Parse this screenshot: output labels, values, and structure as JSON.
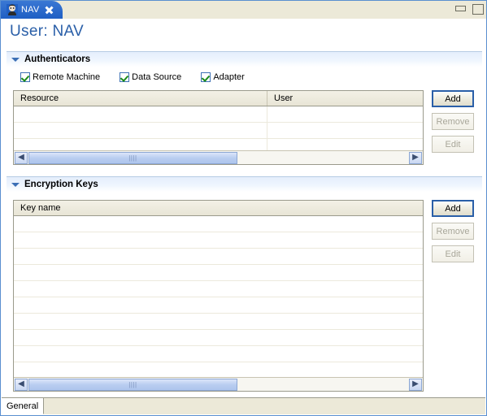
{
  "window": {
    "tab": {
      "label": "NAV",
      "icon": "user-avatar-icon",
      "close_icon": "close-icon"
    },
    "controls": {
      "minimize": "minimize-icon",
      "maximize": "maximize-icon"
    },
    "accent_color": "#2a5fa8",
    "tab_gradient_from": "#3a78d4",
    "tab_gradient_to": "#1f5fc4"
  },
  "page": {
    "title": "User: NAV"
  },
  "sections": [
    {
      "id": "authenticators",
      "title": "Authenticators",
      "expanded": true,
      "twisty_icon": "chevron-down-icon",
      "checkboxes": [
        {
          "label": "Remote Machine",
          "checked": true
        },
        {
          "label": "Data Source",
          "checked": true
        },
        {
          "label": "Adapter",
          "checked": true
        }
      ],
      "table": {
        "columns": [
          "Resource",
          "User"
        ],
        "rows": [],
        "empty_row_count": 4,
        "scrollbar": {
          "left_arrow": "scroll-left-icon",
          "right_arrow": "scroll-right-icon",
          "thumb_percent": 55,
          "thumb_offset_percent": 0,
          "grip": "||||"
        }
      },
      "buttons": [
        {
          "label": "Add",
          "enabled": true,
          "focused": true
        },
        {
          "label": "Remove",
          "enabled": false,
          "focused": false
        },
        {
          "label": "Edit",
          "enabled": false,
          "focused": false
        }
      ]
    },
    {
      "id": "encryption-keys",
      "title": "Encryption Keys",
      "expanded": true,
      "twisty_icon": "chevron-down-icon",
      "checkboxes": [],
      "table": {
        "columns": [
          "Key name"
        ],
        "rows": [],
        "empty_row_count": 10,
        "scrollbar": {
          "left_arrow": "scroll-left-icon",
          "right_arrow": "scroll-right-icon",
          "thumb_percent": 55,
          "thumb_offset_percent": 0,
          "grip": "||||"
        }
      },
      "buttons": [
        {
          "label": "Add",
          "enabled": true,
          "focused": true
        },
        {
          "label": "Remove",
          "enabled": false,
          "focused": false
        },
        {
          "label": "Edit",
          "enabled": false,
          "focused": false
        }
      ]
    }
  ],
  "bottom_tabs": [
    {
      "label": "General",
      "active": true
    }
  ]
}
